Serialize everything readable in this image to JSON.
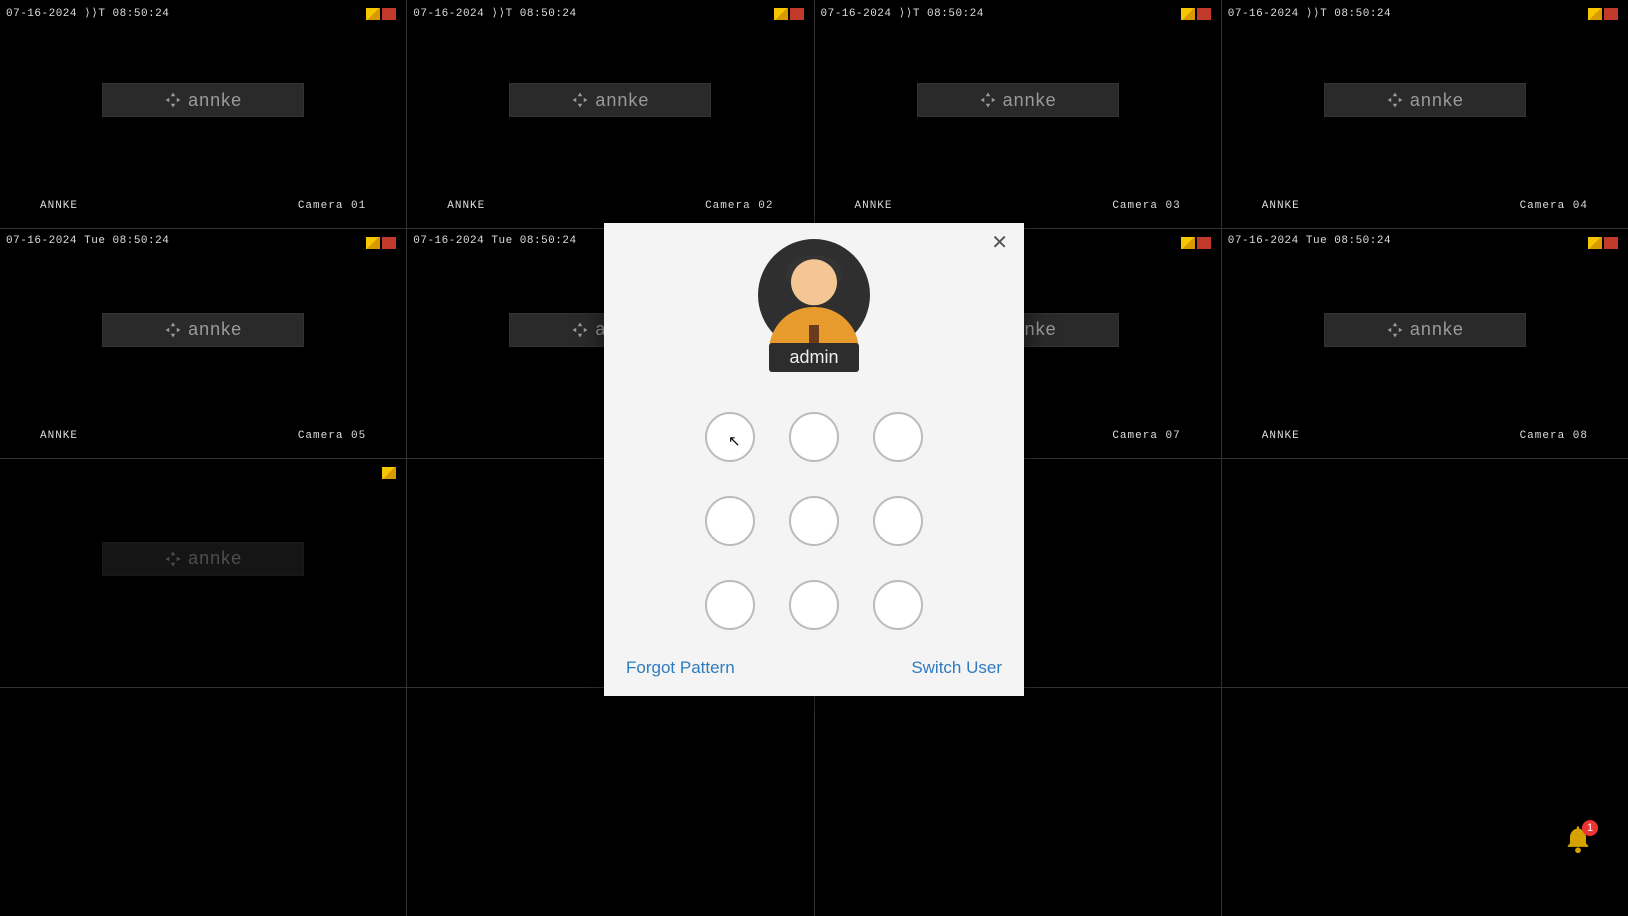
{
  "timestamp_row1": "07-16-2024 ⟩⟩T 08:50:24",
  "timestamp_other": "07-16-2024 Tue 08:50:24",
  "brand_label": "annke",
  "brand_label_upper": "ANNKE",
  "cameras": [
    {
      "cam": "Camera 01",
      "ts_key": "timestamp_row1",
      "yr": true,
      "brand": true
    },
    {
      "cam": "Camera 02",
      "ts_key": "timestamp_row1",
      "yr": true,
      "brand": true
    },
    {
      "cam": "Camera 03",
      "ts_key": "timestamp_row1",
      "yr": true,
      "brand": true
    },
    {
      "cam": "Camera 04",
      "ts_key": "timestamp_row1",
      "yr": true,
      "brand": true
    },
    {
      "cam": "Camera 05",
      "ts_key": "timestamp_other",
      "yr": true,
      "brand": true
    },
    {
      "cam": "",
      "ts_key": "timestamp_other",
      "yr": true,
      "brand": true
    },
    {
      "cam": "Camera 07",
      "ts_key": "timestamp_other",
      "yr": true,
      "brand": true
    },
    {
      "cam": "Camera 08",
      "ts_key": "timestamp_other",
      "yr": true,
      "brand": true
    },
    {
      "cam": "",
      "ts_key": "",
      "yr": false,
      "brand": true,
      "yellow_only": true,
      "dim": true
    },
    {
      "cam": "",
      "ts_key": "",
      "yr": false,
      "brand": false
    },
    {
      "cam": "",
      "ts_key": "",
      "yr": false,
      "brand": false
    },
    {
      "cam": "",
      "ts_key": "",
      "yr": false,
      "brand": false
    },
    {
      "cam": "",
      "ts_key": "",
      "yr": false,
      "brand": false
    },
    {
      "cam": "",
      "ts_key": "",
      "yr": false,
      "brand": false
    },
    {
      "cam": "",
      "ts_key": "",
      "yr": false,
      "brand": false
    },
    {
      "cam": "",
      "ts_key": "",
      "yr": false,
      "brand": false
    }
  ],
  "dialog": {
    "user": "admin",
    "forgot": "Forgot Pattern",
    "switch": "Switch User"
  },
  "bell_badge": "1"
}
